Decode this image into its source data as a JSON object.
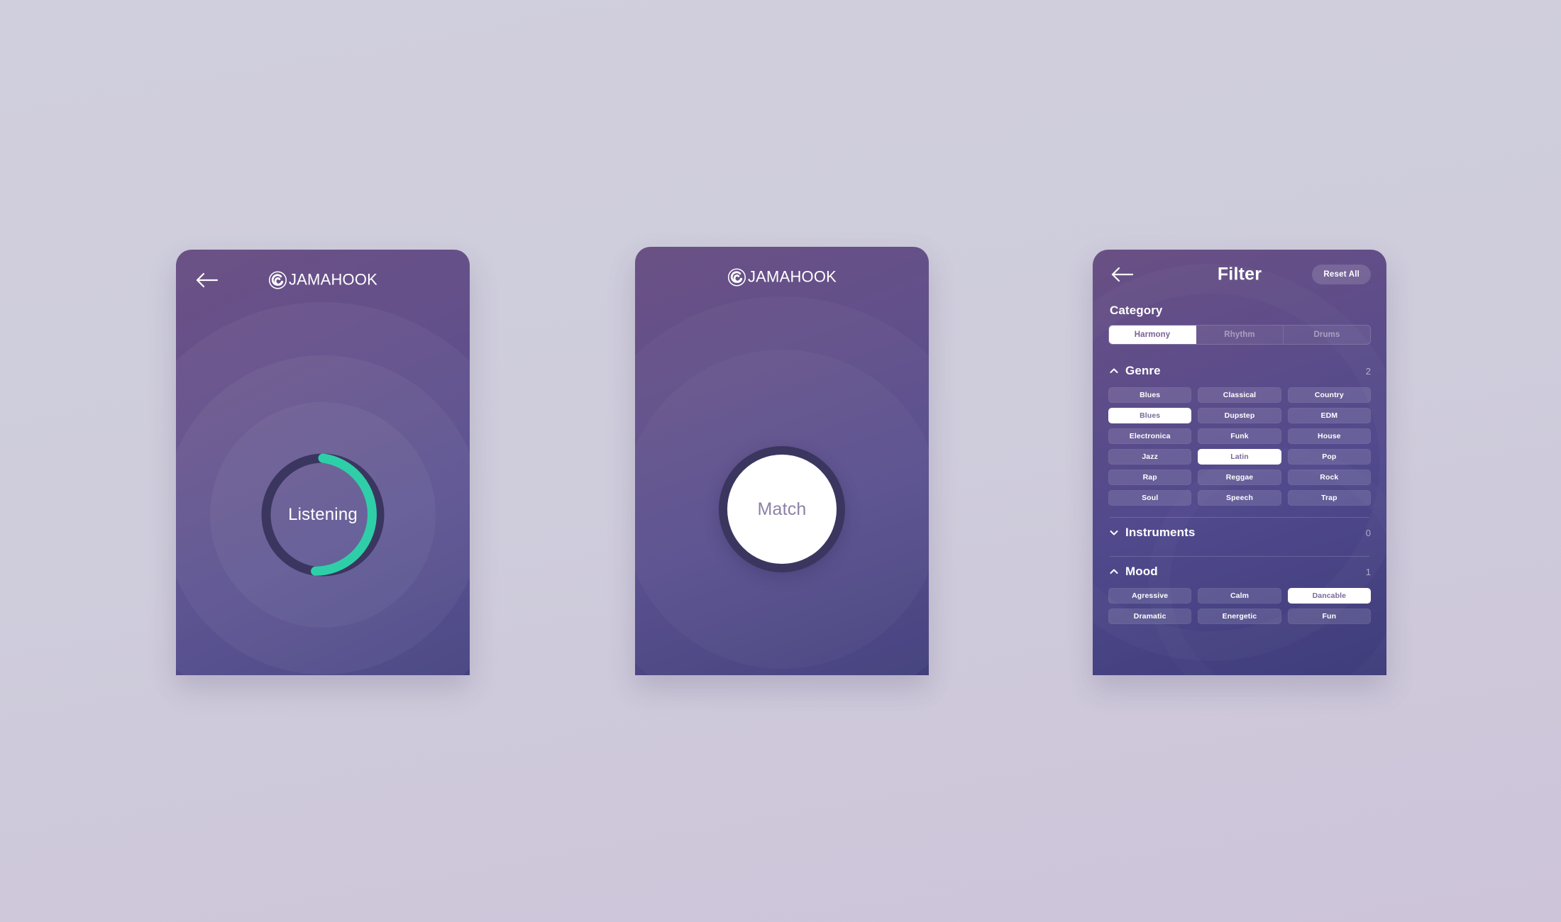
{
  "theme": {
    "accent_teal": "#2ecfa8",
    "dial_track": "#3b3660",
    "card_purple_top": "#6b5185",
    "card_purple_bottom": "#423f7c",
    "page_bg_top": "#d0cfdd",
    "page_bg_bottom": "#cdc4d9"
  },
  "brand": {
    "name": "JAMAHOOK",
    "mark_icon": "jamahook-spiral-icon"
  },
  "screens": {
    "listening": {
      "back_icon": "back-arrow-icon",
      "status_label": "Listening",
      "progress_percent": 48
    },
    "match": {
      "button_label": "Match"
    },
    "filter": {
      "back_icon": "back-arrow-icon",
      "title": "Filter",
      "reset_label": "Reset All",
      "category": {
        "label": "Category",
        "options": [
          "Harmony",
          "Rhythm",
          "Drums"
        ],
        "selected": "Harmony"
      },
      "groups": [
        {
          "name": "Genre",
          "count": "2",
          "expanded": true,
          "chevron_icon": "chevron-up-icon",
          "chips": [
            {
              "label": "Blues",
              "selected": false
            },
            {
              "label": "Classical",
              "selected": false
            },
            {
              "label": "Country",
              "selected": false
            },
            {
              "label": "Blues",
              "selected": true
            },
            {
              "label": "Dupstep",
              "selected": false
            },
            {
              "label": "EDM",
              "selected": false
            },
            {
              "label": "Electronica",
              "selected": false
            },
            {
              "label": "Funk",
              "selected": false
            },
            {
              "label": "House",
              "selected": false
            },
            {
              "label": "Jazz",
              "selected": false
            },
            {
              "label": "Latin",
              "selected": true
            },
            {
              "label": "Pop",
              "selected": false
            },
            {
              "label": "Rap",
              "selected": false
            },
            {
              "label": "Reggae",
              "selected": false
            },
            {
              "label": "Rock",
              "selected": false
            },
            {
              "label": "Soul",
              "selected": false
            },
            {
              "label": "Speech",
              "selected": false
            },
            {
              "label": "Trap",
              "selected": false
            }
          ]
        },
        {
          "name": "Instruments",
          "count": "0",
          "expanded": false,
          "chevron_icon": "chevron-down-icon",
          "chips": []
        },
        {
          "name": "Mood",
          "count": "1",
          "expanded": true,
          "chevron_icon": "chevron-up-icon",
          "chips": [
            {
              "label": "Agressive",
              "selected": false
            },
            {
              "label": "Calm",
              "selected": false
            },
            {
              "label": "Dancable",
              "selected": true
            },
            {
              "label": "Dramatic",
              "selected": false
            },
            {
              "label": "Energetic",
              "selected": false
            },
            {
              "label": "Fun",
              "selected": false
            }
          ]
        }
      ]
    }
  }
}
